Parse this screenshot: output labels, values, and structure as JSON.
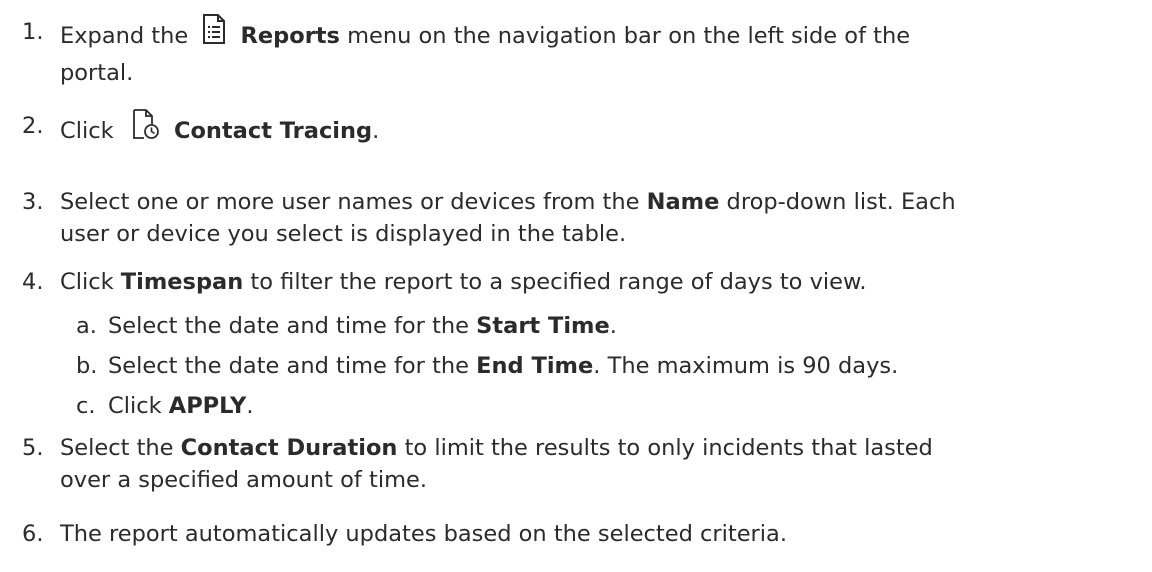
{
  "steps": [
    {
      "num": "1.",
      "pre": "Expand the",
      "icon": "report-document-icon",
      "bold": "Reports",
      "post": "menu on the navigation bar on the left side of the",
      "line2": "portal."
    },
    {
      "num": "2.",
      "pre": "Click",
      "icon": "contact-tracing-icon",
      "bold": "Contact Tracing",
      "post": "."
    },
    {
      "num": "3.",
      "pre": "Select one or more user names or devices from the",
      "bold": "Name",
      "post": "drop-down list. Each",
      "line2": "user or device you select is displayed in the table."
    },
    {
      "num": "4.",
      "pre": "Click",
      "bold": "Timespan",
      "post": "to filter the report to a specified range of days to view."
    },
    {
      "num": "a.",
      "pre": "Select the date and time for the",
      "bold": "Start Time",
      "post": "."
    },
    {
      "num": "b.",
      "pre": "Select the date and time for the",
      "bold": "End Time",
      "post": ". The maximum is 90 days."
    },
    {
      "num": "c.",
      "pre": "Click",
      "bold": "APPLY",
      "post": "."
    },
    {
      "num": "5.",
      "pre": "Select the",
      "bold": "Contact Duration",
      "post": "to limit the results to only incidents that lasted",
      "line2": "over a specified amount of time."
    },
    {
      "num": "6.",
      "text": "The report automatically updates based on the selected criteria."
    }
  ]
}
